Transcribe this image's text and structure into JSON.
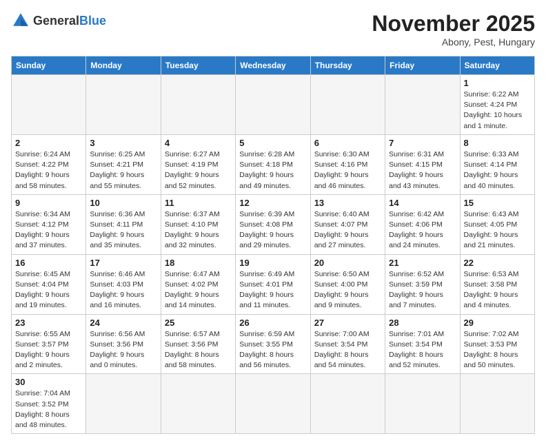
{
  "logo": {
    "text_general": "General",
    "text_blue": "Blue"
  },
  "title": {
    "month_year": "November 2025",
    "location": "Abony, Pest, Hungary"
  },
  "weekdays": [
    "Sunday",
    "Monday",
    "Tuesday",
    "Wednesday",
    "Thursday",
    "Friday",
    "Saturday"
  ],
  "weeks": [
    [
      {
        "day": "",
        "info": ""
      },
      {
        "day": "",
        "info": ""
      },
      {
        "day": "",
        "info": ""
      },
      {
        "day": "",
        "info": ""
      },
      {
        "day": "",
        "info": ""
      },
      {
        "day": "",
        "info": ""
      },
      {
        "day": "1",
        "info": "Sunrise: 6:22 AM\nSunset: 4:24 PM\nDaylight: 10 hours and 1 minute."
      }
    ],
    [
      {
        "day": "2",
        "info": "Sunrise: 6:24 AM\nSunset: 4:22 PM\nDaylight: 9 hours and 58 minutes."
      },
      {
        "day": "3",
        "info": "Sunrise: 6:25 AM\nSunset: 4:21 PM\nDaylight: 9 hours and 55 minutes."
      },
      {
        "day": "4",
        "info": "Sunrise: 6:27 AM\nSunset: 4:19 PM\nDaylight: 9 hours and 52 minutes."
      },
      {
        "day": "5",
        "info": "Sunrise: 6:28 AM\nSunset: 4:18 PM\nDaylight: 9 hours and 49 minutes."
      },
      {
        "day": "6",
        "info": "Sunrise: 6:30 AM\nSunset: 4:16 PM\nDaylight: 9 hours and 46 minutes."
      },
      {
        "day": "7",
        "info": "Sunrise: 6:31 AM\nSunset: 4:15 PM\nDaylight: 9 hours and 43 minutes."
      },
      {
        "day": "8",
        "info": "Sunrise: 6:33 AM\nSunset: 4:14 PM\nDaylight: 9 hours and 40 minutes."
      }
    ],
    [
      {
        "day": "9",
        "info": "Sunrise: 6:34 AM\nSunset: 4:12 PM\nDaylight: 9 hours and 37 minutes."
      },
      {
        "day": "10",
        "info": "Sunrise: 6:36 AM\nSunset: 4:11 PM\nDaylight: 9 hours and 35 minutes."
      },
      {
        "day": "11",
        "info": "Sunrise: 6:37 AM\nSunset: 4:10 PM\nDaylight: 9 hours and 32 minutes."
      },
      {
        "day": "12",
        "info": "Sunrise: 6:39 AM\nSunset: 4:08 PM\nDaylight: 9 hours and 29 minutes."
      },
      {
        "day": "13",
        "info": "Sunrise: 6:40 AM\nSunset: 4:07 PM\nDaylight: 9 hours and 27 minutes."
      },
      {
        "day": "14",
        "info": "Sunrise: 6:42 AM\nSunset: 4:06 PM\nDaylight: 9 hours and 24 minutes."
      },
      {
        "day": "15",
        "info": "Sunrise: 6:43 AM\nSunset: 4:05 PM\nDaylight: 9 hours and 21 minutes."
      }
    ],
    [
      {
        "day": "16",
        "info": "Sunrise: 6:45 AM\nSunset: 4:04 PM\nDaylight: 9 hours and 19 minutes."
      },
      {
        "day": "17",
        "info": "Sunrise: 6:46 AM\nSunset: 4:03 PM\nDaylight: 9 hours and 16 minutes."
      },
      {
        "day": "18",
        "info": "Sunrise: 6:47 AM\nSunset: 4:02 PM\nDaylight: 9 hours and 14 minutes."
      },
      {
        "day": "19",
        "info": "Sunrise: 6:49 AM\nSunset: 4:01 PM\nDaylight: 9 hours and 11 minutes."
      },
      {
        "day": "20",
        "info": "Sunrise: 6:50 AM\nSunset: 4:00 PM\nDaylight: 9 hours and 9 minutes."
      },
      {
        "day": "21",
        "info": "Sunrise: 6:52 AM\nSunset: 3:59 PM\nDaylight: 9 hours and 7 minutes."
      },
      {
        "day": "22",
        "info": "Sunrise: 6:53 AM\nSunset: 3:58 PM\nDaylight: 9 hours and 4 minutes."
      }
    ],
    [
      {
        "day": "23",
        "info": "Sunrise: 6:55 AM\nSunset: 3:57 PM\nDaylight: 9 hours and 2 minutes."
      },
      {
        "day": "24",
        "info": "Sunrise: 6:56 AM\nSunset: 3:56 PM\nDaylight: 9 hours and 0 minutes."
      },
      {
        "day": "25",
        "info": "Sunrise: 6:57 AM\nSunset: 3:56 PM\nDaylight: 8 hours and 58 minutes."
      },
      {
        "day": "26",
        "info": "Sunrise: 6:59 AM\nSunset: 3:55 PM\nDaylight: 8 hours and 56 minutes."
      },
      {
        "day": "27",
        "info": "Sunrise: 7:00 AM\nSunset: 3:54 PM\nDaylight: 8 hours and 54 minutes."
      },
      {
        "day": "28",
        "info": "Sunrise: 7:01 AM\nSunset: 3:54 PM\nDaylight: 8 hours and 52 minutes."
      },
      {
        "day": "29",
        "info": "Sunrise: 7:02 AM\nSunset: 3:53 PM\nDaylight: 8 hours and 50 minutes."
      }
    ],
    [
      {
        "day": "30",
        "info": "Sunrise: 7:04 AM\nSunset: 3:52 PM\nDaylight: 8 hours and 48 minutes."
      },
      {
        "day": "",
        "info": ""
      },
      {
        "day": "",
        "info": ""
      },
      {
        "day": "",
        "info": ""
      },
      {
        "day": "",
        "info": ""
      },
      {
        "day": "",
        "info": ""
      },
      {
        "day": "",
        "info": ""
      }
    ]
  ]
}
